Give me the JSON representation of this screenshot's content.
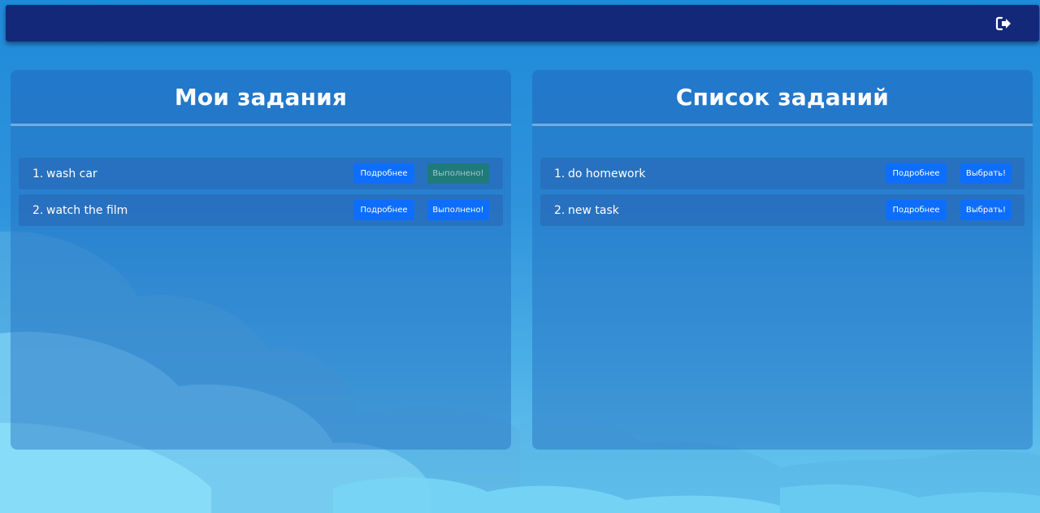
{
  "app": {
    "logout_icon": "sign-out-icon"
  },
  "colors": {
    "topbar": "#14287a",
    "primary_button": "#0d6efd",
    "completed_button": "#1f7a7a"
  },
  "my_tasks": {
    "title": "Мои задания",
    "items": [
      {
        "num": "1.",
        "text": "wash car",
        "details_label": "Подробнее",
        "action_label": "Выполнено!",
        "action_state": "disabled"
      },
      {
        "num": "2.",
        "text": "watch the film",
        "details_label": "Подробнее",
        "action_label": "Выполнено!",
        "action_state": "enabled"
      }
    ]
  },
  "task_list": {
    "title": "Список заданий",
    "items": [
      {
        "num": "1.",
        "text": "do homework",
        "details_label": "Подробнее",
        "action_label": "Выбрать!"
      },
      {
        "num": "2.",
        "text": "new task",
        "details_label": "Подробнее",
        "action_label": "Выбрать!"
      }
    ]
  }
}
